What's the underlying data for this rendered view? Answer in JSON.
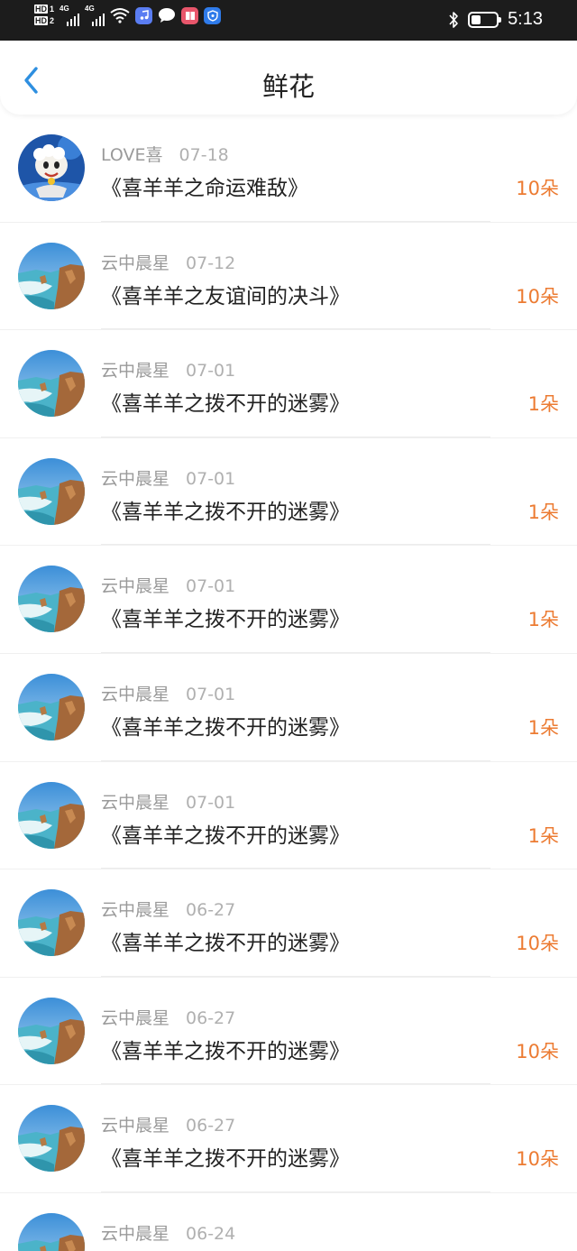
{
  "status_bar": {
    "sim1_label": "HD",
    "sim1_num": "1",
    "sim2_label": "HD",
    "sim2_num": "2",
    "net1": "4G",
    "net2": "4G",
    "time": "5:13",
    "battery_level": 0.4,
    "icons": [
      "wifi-icon",
      "music-app-icon",
      "message-bubble-icon",
      "book-app-icon",
      "shield-app-icon",
      "bluetooth-icon",
      "battery-icon"
    ]
  },
  "header": {
    "title": "鲜花",
    "back_icon": "chevron-left-icon"
  },
  "colors": {
    "accent_blue": "#2e8fe0",
    "count_orange": "#ec7b32"
  },
  "items": [
    {
      "user": "LOVE喜",
      "date": "07-18",
      "title": "《喜羊羊之命运难敌》",
      "count": "10朵",
      "avatar": "cartoon-goat"
    },
    {
      "user": "云中晨星",
      "date": "07-12",
      "title": "《喜羊羊之友谊间的决斗》",
      "count": "10朵",
      "avatar": "coast"
    },
    {
      "user": "云中晨星",
      "date": "07-01",
      "title": "《喜羊羊之拨不开的迷雾》",
      "count": "1朵",
      "avatar": "coast"
    },
    {
      "user": "云中晨星",
      "date": "07-01",
      "title": "《喜羊羊之拨不开的迷雾》",
      "count": "1朵",
      "avatar": "coast"
    },
    {
      "user": "云中晨星",
      "date": "07-01",
      "title": "《喜羊羊之拨不开的迷雾》",
      "count": "1朵",
      "avatar": "coast"
    },
    {
      "user": "云中晨星",
      "date": "07-01",
      "title": "《喜羊羊之拨不开的迷雾》",
      "count": "1朵",
      "avatar": "coast"
    },
    {
      "user": "云中晨星",
      "date": "07-01",
      "title": "《喜羊羊之拨不开的迷雾》",
      "count": "1朵",
      "avatar": "coast"
    },
    {
      "user": "云中晨星",
      "date": "06-27",
      "title": "《喜羊羊之拨不开的迷雾》",
      "count": "10朵",
      "avatar": "coast"
    },
    {
      "user": "云中晨星",
      "date": "06-27",
      "title": "《喜羊羊之拨不开的迷雾》",
      "count": "10朵",
      "avatar": "coast"
    },
    {
      "user": "云中晨星",
      "date": "06-27",
      "title": "《喜羊羊之拨不开的迷雾》",
      "count": "10朵",
      "avatar": "coast"
    },
    {
      "user": "云中晨星",
      "date": "06-24",
      "title": "",
      "count": "",
      "avatar": "coast"
    }
  ]
}
